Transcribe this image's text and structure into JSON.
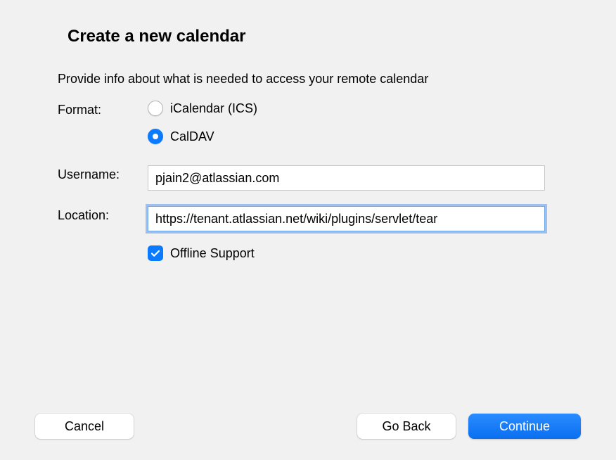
{
  "title": "Create a new calendar",
  "subtitle": "Provide info about what is needed to access your remote calendar",
  "labels": {
    "format": "Format:",
    "username": "Username:",
    "location": "Location:"
  },
  "format_options": {
    "ics": {
      "label": "iCalendar (ICS)",
      "selected": false
    },
    "caldav": {
      "label": "CalDAV",
      "selected": true
    }
  },
  "fields": {
    "username": "pjain2@atlassian.com",
    "location": "https://tenant.atlassian.net/wiki/plugins/servlet/tear"
  },
  "offline_support": {
    "label": "Offline Support",
    "checked": true
  },
  "buttons": {
    "cancel": "Cancel",
    "go_back": "Go Back",
    "continue": "Continue"
  }
}
